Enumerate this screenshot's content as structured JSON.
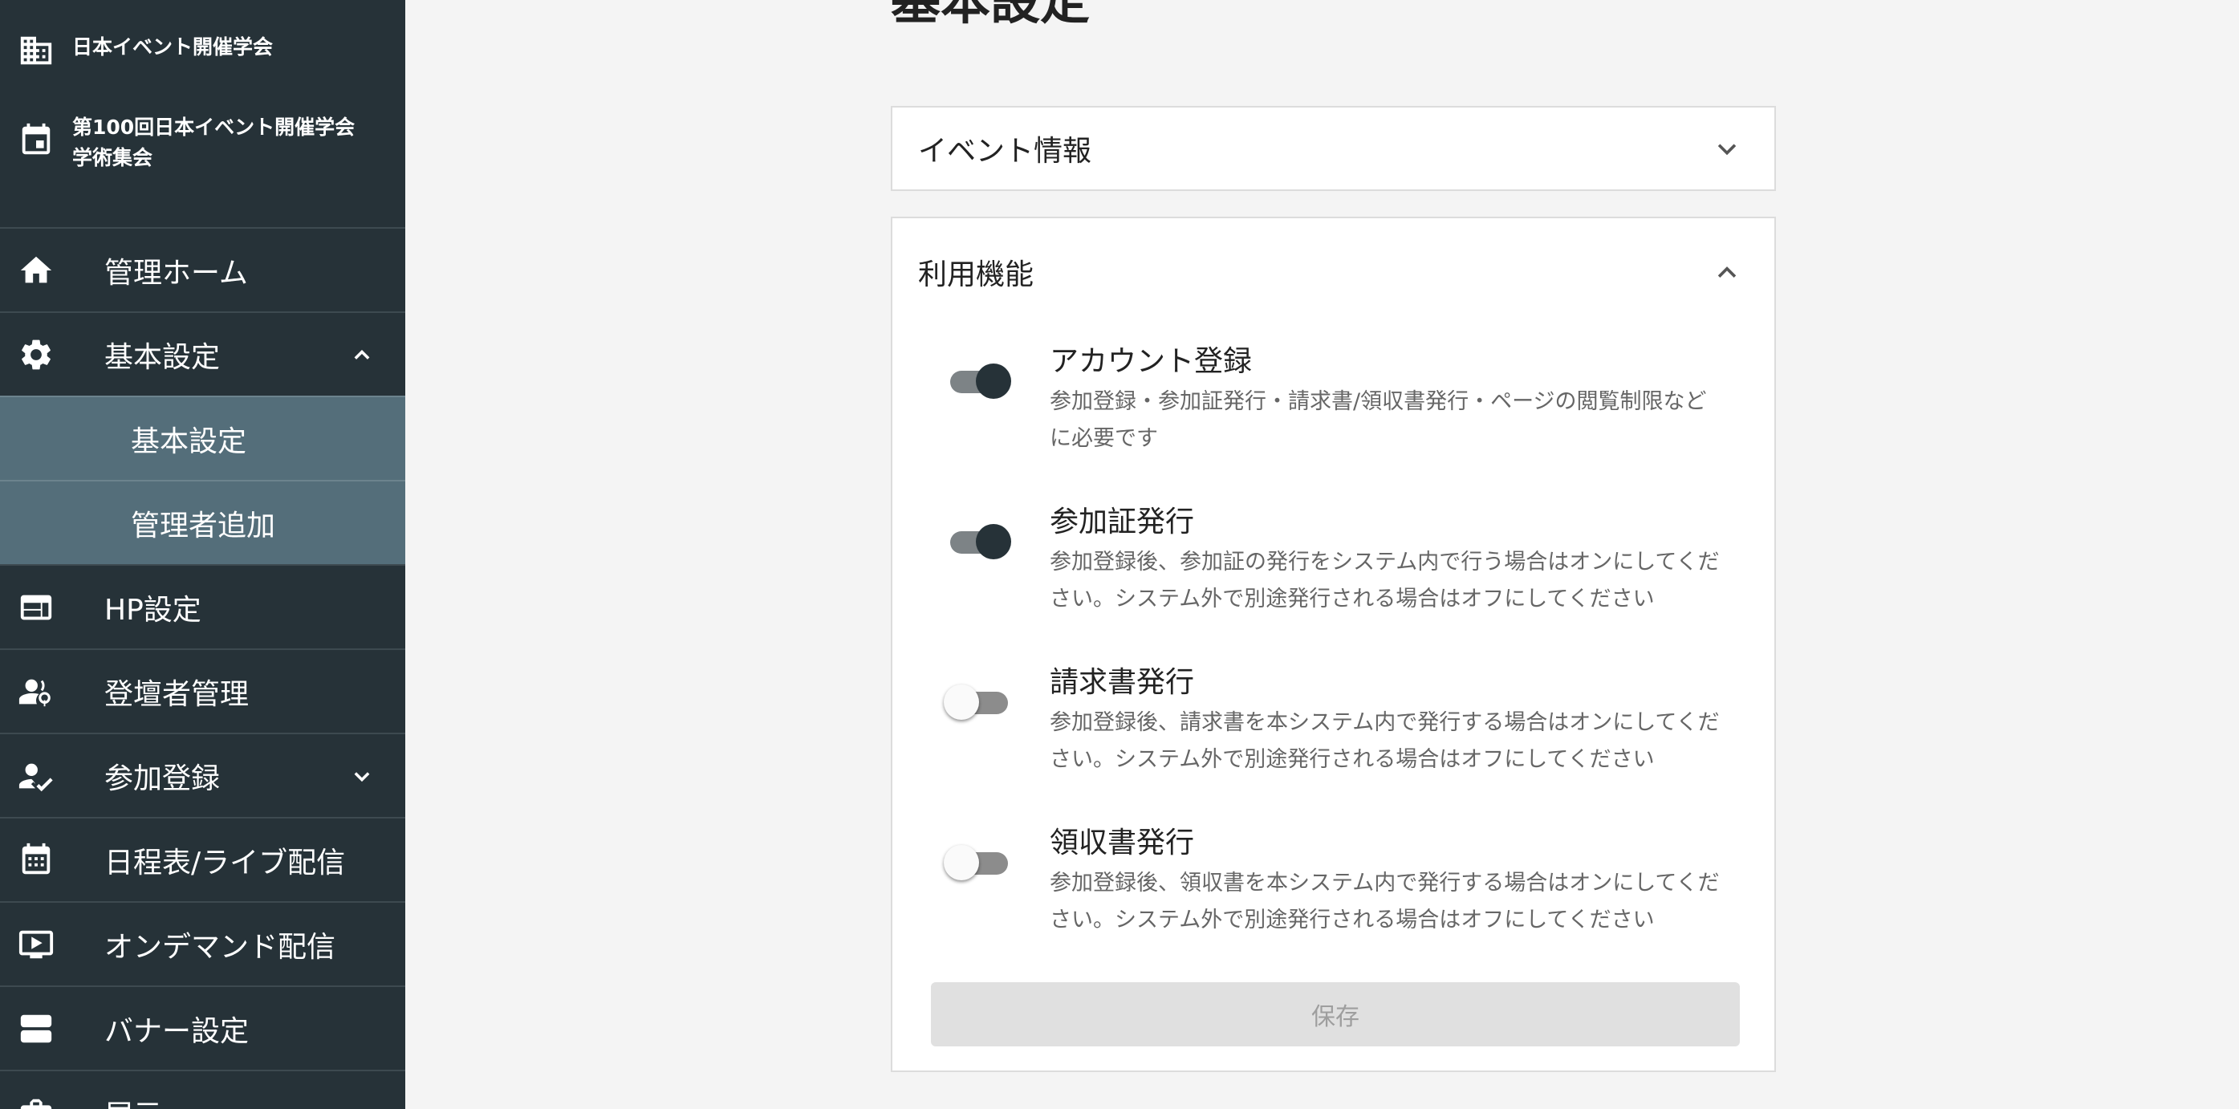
{
  "sidebar": {
    "org_name": "日本イベント開催学会",
    "event_name_line1": "第100回日本イベント開催学会",
    "event_name_line2": "学術集会",
    "items": [
      {
        "label": "管理ホーム",
        "icon": "home-icon"
      },
      {
        "label": "基本設定",
        "icon": "gear-icon",
        "expanded": true
      },
      {
        "label": "基本設定",
        "sub": true,
        "active": true
      },
      {
        "label": "管理者追加",
        "sub": true
      },
      {
        "label": "HP設定",
        "icon": "web-layout-icon"
      },
      {
        "label": "登壇者管理",
        "icon": "speaker-icon"
      },
      {
        "label": "参加登録",
        "icon": "user-check-icon",
        "expanded": false
      },
      {
        "label": "日程表/ライブ配信",
        "icon": "calendar-icon"
      },
      {
        "label": "オンデマンド配信",
        "icon": "play-screen-icon"
      },
      {
        "label": "バナー設定",
        "icon": "banner-icon"
      },
      {
        "label": "展示",
        "icon": "briefcase-icon"
      }
    ]
  },
  "main": {
    "page_title": "基本設定",
    "event_info_panel": {
      "title": "イベント情報",
      "expanded": false
    },
    "features_panel": {
      "title": "利用機能",
      "expanded": true,
      "features": [
        {
          "title": "アカウント登録",
          "desc_line1": "参加登録・参加証発行・請求書/領収書発行・ページの閲覧制限など",
          "desc_line2": "に必要です",
          "enabled": true
        },
        {
          "title": "参加証発行",
          "desc_line1": "参加登録後、参加証の発行をシステム内で行う場合はオンにしてくだ",
          "desc_line2": "さい。システム外で別途発行される場合はオフにしてください",
          "enabled": true
        },
        {
          "title": "請求書発行",
          "desc_line1": "参加登録後、請求書を本システム内で発行する場合はオンにしてくだ",
          "desc_line2": "さい。システム外で別途発行される場合はオフにしてください",
          "enabled": false
        },
        {
          "title": "領収書発行",
          "desc_line1": "参加登録後、領収書を本システム内で発行する場合はオンにしてくだ",
          "desc_line2": "さい。システム外で別途発行される場合はオフにしてください",
          "enabled": false
        }
      ],
      "save_label": "保存"
    }
  },
  "colors": {
    "sidebar_bg": "#263238",
    "sidebar_sub_bg": "#546e7a",
    "page_bg": "#f4f4f4",
    "toggle_on_knob": "#263238",
    "save_disabled_bg": "#e0e0e0"
  }
}
